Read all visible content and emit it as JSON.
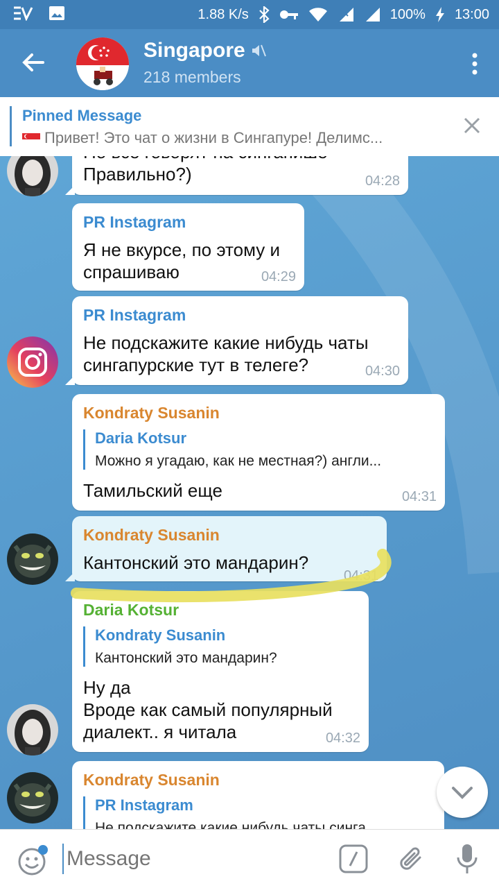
{
  "status_bar": {
    "speed": "1.88 K/s",
    "battery": "100%",
    "time": "13:00",
    "icons": [
      "vpn-icon",
      "image-icon",
      "bluetooth-icon",
      "key-icon",
      "wifi-icon",
      "signal-icon",
      "signal-r-icon",
      "charging-icon"
    ]
  },
  "header": {
    "title": "Singapore",
    "subtitle": "218 members"
  },
  "pinned": {
    "title": "Pinned Message",
    "text": "Привет! Это чат о жизни в Сингапуре!  Делимс..."
  },
  "messages": [
    {
      "id": "m1",
      "sender": "",
      "text_partial_top": "Но все говорят на сингапише",
      "text": "Правильно?)",
      "time": "04:28"
    },
    {
      "id": "m2",
      "sender": "PR Instagram",
      "text": "Я не вкурсе, по этому и спрашиваю",
      "time": "04:29"
    },
    {
      "id": "m3",
      "sender": "PR Instagram",
      "text": "Не подскажите какие нибудь чаты сингапурские тут в телеге?",
      "time": "04:30"
    },
    {
      "id": "m4",
      "sender": "Kondraty Susanin",
      "reply_name": "Daria Kotsur",
      "reply_text": "Можно я угадаю, как не местная?) англи...",
      "text": "Тамильский еще",
      "time": "04:31"
    },
    {
      "id": "m5",
      "sender": "Kondraty Susanin",
      "text": "Кантонский это мандарин?",
      "time": "04:31"
    },
    {
      "id": "m6",
      "sender": "Daria Kotsur",
      "reply_name": "Kondraty Susanin",
      "reply_text": "Кантонский это мандарин?",
      "text": "Ну да\nВроде как самый популярный диалект.. я читала",
      "time": "04:32"
    },
    {
      "id": "m7",
      "sender": "Kondraty Susanin",
      "reply_name": "PR Instagram",
      "reply_text": "Не подскажите какие нибудь чаты синга..."
    }
  ],
  "input": {
    "placeholder": "Message"
  },
  "colors": {
    "header": "#4b8dc5",
    "status_bar": "#3f7fb7",
    "chat_bg": "#5a9fcf",
    "name_pr": "#3b8bd0",
    "name_kondraty": "#d9862f",
    "name_daria": "#55b134",
    "highlight": "#e3f4fa",
    "marker": "#e8e060"
  }
}
